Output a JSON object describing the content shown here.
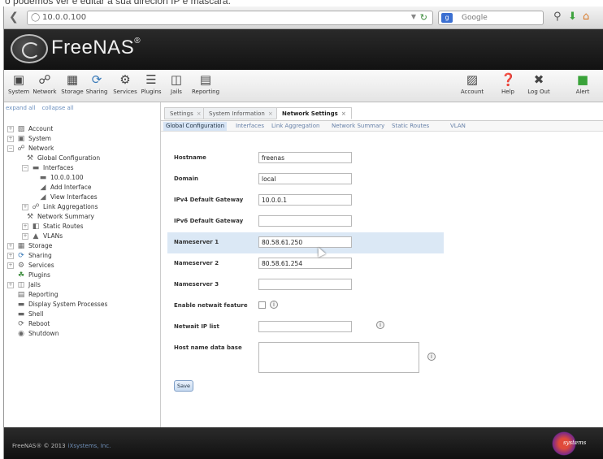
{
  "caption": "o podemos ver e editar a sua direcion IP e mascara.",
  "browser": {
    "url": "10.0.0.100",
    "search_placeholder": "Google",
    "search_engine_letter": "g"
  },
  "app": {
    "name": "FreeNAS",
    "trademark": "®"
  },
  "toolbar": {
    "items": [
      {
        "label": "System",
        "icon": "system-icon"
      },
      {
        "label": "Network",
        "icon": "network-icon"
      },
      {
        "label": "Storage",
        "icon": "storage-icon"
      },
      {
        "label": "Sharing",
        "icon": "sharing-icon"
      },
      {
        "label": "Services",
        "icon": "services-icon"
      },
      {
        "label": "Plugins",
        "icon": "plugins-icon"
      },
      {
        "label": "Jails",
        "icon": "jails-icon"
      },
      {
        "label": "Reporting",
        "icon": "reporting-icon"
      },
      {
        "label": "Account",
        "icon": "account-icon"
      },
      {
        "label": "Help",
        "icon": "help-icon"
      },
      {
        "label": "Log Out",
        "icon": "logout-icon"
      },
      {
        "label": "Alert",
        "icon": "alert-icon"
      }
    ]
  },
  "sidebar": {
    "expand_all": "expand all",
    "collapse_all": "collapse all",
    "items": [
      {
        "label": "Account",
        "icon": "account-icon"
      },
      {
        "label": "System",
        "icon": "system-icon"
      },
      {
        "label": "Network",
        "icon": "network-icon"
      },
      {
        "label": "Global Configuration",
        "icon": "wrench-icon"
      },
      {
        "label": "Interfaces",
        "icon": "interface-icon"
      },
      {
        "label": "10.0.0.100",
        "icon": "interface-icon"
      },
      {
        "label": "Add Interface",
        "icon": "add-icon"
      },
      {
        "label": "View Interfaces",
        "icon": "view-icon"
      },
      {
        "label": "Link Aggregations",
        "icon": "link-icon"
      },
      {
        "label": "Network Summary",
        "icon": "wrench-icon"
      },
      {
        "label": "Static Routes",
        "icon": "routes-icon"
      },
      {
        "label": "VLANs",
        "icon": "vlan-icon"
      },
      {
        "label": "Storage",
        "icon": "storage-icon"
      },
      {
        "label": "Sharing",
        "icon": "sharing-icon"
      },
      {
        "label": "Services",
        "icon": "services-icon"
      },
      {
        "label": "Plugins",
        "icon": "plugins-icon"
      },
      {
        "label": "Jails",
        "icon": "jails-icon"
      },
      {
        "label": "Reporting",
        "icon": "reporting-icon"
      },
      {
        "label": "Display System Processes",
        "icon": "processes-icon"
      },
      {
        "label": "Shell",
        "icon": "shell-icon"
      },
      {
        "label": "Reboot",
        "icon": "reboot-icon"
      },
      {
        "label": "Shutdown",
        "icon": "shutdown-icon"
      }
    ]
  },
  "tabs": [
    {
      "label": "Settings",
      "close": "×"
    },
    {
      "label": "System Information",
      "close": "×"
    },
    {
      "label": "Network Settings",
      "close": "×"
    }
  ],
  "subtabs": [
    "Global Configuration",
    "Interfaces",
    "Link Aggregation",
    "Network Summary",
    "Static Routes",
    "VLAN"
  ],
  "form": {
    "hostname": {
      "label": "Hostname",
      "value": "freenas"
    },
    "domain": {
      "label": "Domain",
      "value": "local"
    },
    "ipv4_gateway": {
      "label": "IPv4 Default Gateway",
      "value": "10.0.0.1"
    },
    "ipv6_gateway": {
      "label": "IPv6 Default Gateway",
      "value": ""
    },
    "nameserver1": {
      "label": "Nameserver 1",
      "value": "80.58.61.250"
    },
    "nameserver2": {
      "label": "Nameserver 2",
      "value": "80.58.61.254"
    },
    "nameserver3": {
      "label": "Nameserver 3",
      "value": ""
    },
    "netwait": {
      "label": "Enable netwait feature"
    },
    "netwait_ip": {
      "label": "Netwait IP list",
      "value": ""
    },
    "hosts_db": {
      "label": "Host name data base",
      "value": ""
    },
    "help_glyph": "i",
    "save_label": "Save"
  },
  "footer": {
    "copyright": "FreeNAS® © 2013",
    "company": "iXsystems, Inc.",
    "logo_text": "systems"
  }
}
